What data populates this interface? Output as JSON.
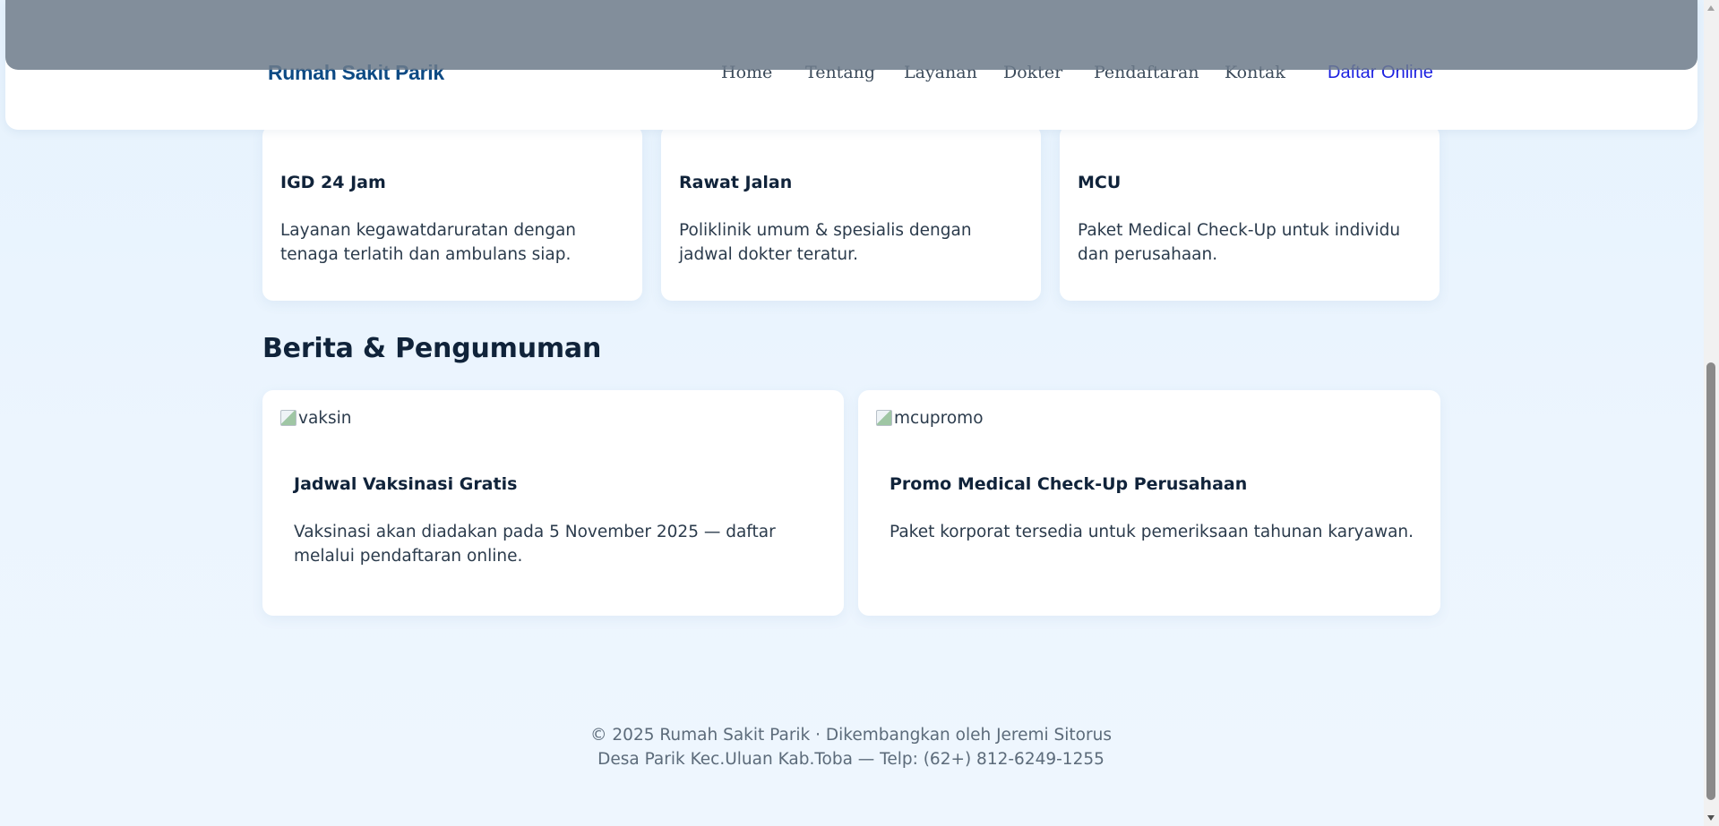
{
  "header": {
    "brand": "Rumah Sakit Parik",
    "nav": [
      "Home",
      "Tentang",
      "Layanan",
      "Dokter",
      "Pendaftaran",
      "Kontak"
    ],
    "cta": "Daftar Online"
  },
  "services": [
    {
      "title": "IGD 24 Jam",
      "desc": "Layanan kegawatdaruratan dengan tenaga terlatih dan ambulans siap."
    },
    {
      "title": "Rawat Jalan",
      "desc": "Poliklinik umum & spesialis dengan jadwal dokter teratur."
    },
    {
      "title": "MCU",
      "desc": "Paket Medical Check-Up untuk individu dan perusahaan."
    }
  ],
  "news": {
    "title": "Berita & Pengumuman",
    "items": [
      {
        "image_alt": "vaksin",
        "title": "Jadwal Vaksinasi Gratis",
        "desc": "Vaksinasi akan diadakan pada 5 November 2025 — daftar melalui pendaftaran online."
      },
      {
        "image_alt": "mcupromo",
        "title": "Promo Medical Check-Up Perusahaan",
        "desc": "Paket korporat tersedia untuk pemeriksaan tahunan karyawan."
      }
    ]
  },
  "footer": {
    "line1": "© 2025 Rumah Sakit Parik · Dikembangkan oleh Jeremi Sitorus",
    "line2": "Desa Parik Kec.Uluan Kab.Toba — Telp: (62+) 812-6249-1255"
  },
  "colors": {
    "brand": "#0d4a84",
    "cta": "#1a1fe0",
    "page_bg": "#e9f4fe",
    "card_bg": "#ffffff"
  }
}
